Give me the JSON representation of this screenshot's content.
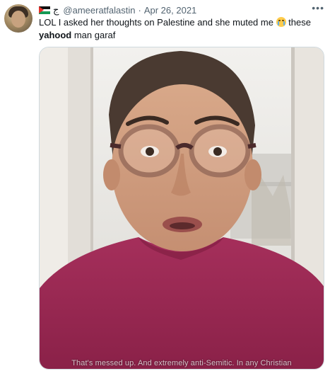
{
  "tweet": {
    "display_name": "ج",
    "handle": "@ameeratfalastin",
    "separator": "·",
    "date": "Apr 26, 2021",
    "more_label": "•••",
    "text_before": "LOL I asked her thoughts on Palestine and she muted me ",
    "text_after": " these ",
    "text_bold": "yahood",
    "text_end": " man garaf",
    "emoji": "loudly-crying-face"
  },
  "media": {
    "type": "video-frame",
    "caption": "That's messed up. And extremely anti-Semitic. In any Christian"
  },
  "colors": {
    "text_primary": "#0f1419",
    "text_secondary": "#536471",
    "border": "#cfd9de",
    "sweater": "#9e2a55"
  }
}
